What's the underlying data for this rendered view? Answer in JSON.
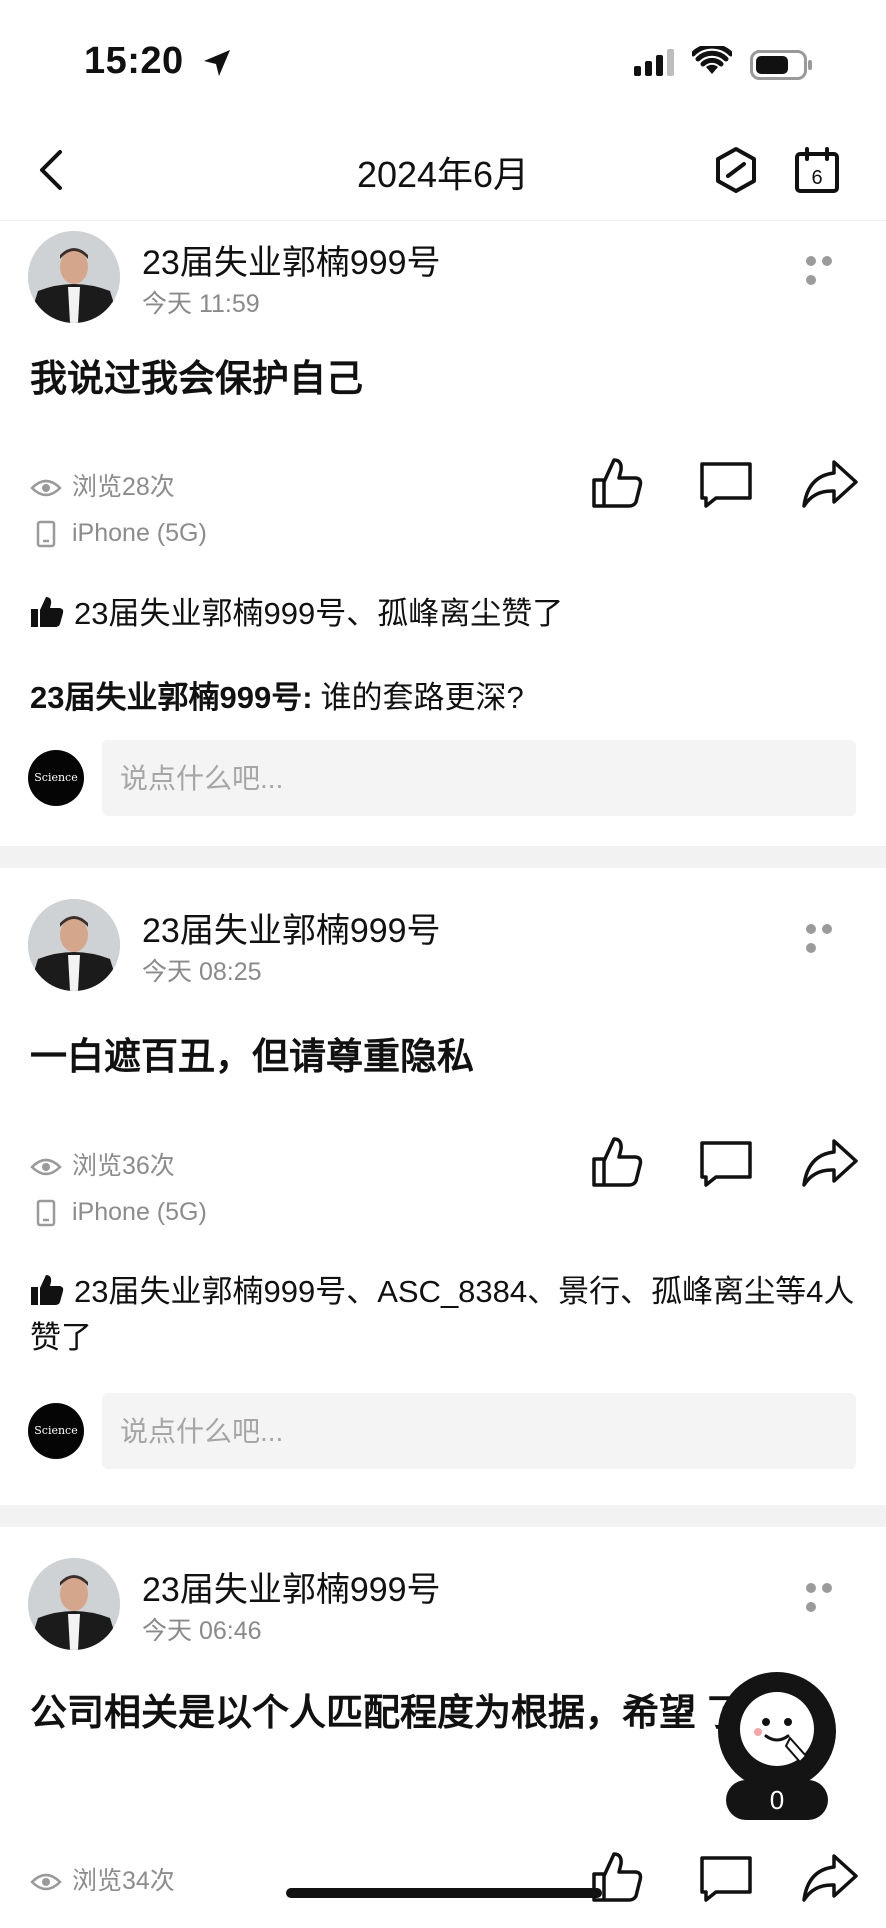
{
  "status_bar": {
    "time": "15:20"
  },
  "nav": {
    "title": "2024年6月",
    "calendar_day": "6"
  },
  "posts": [
    {
      "username": "23届失业郭楠999号",
      "time": "今天 11:59",
      "content": "我说过我会保护自己",
      "views": "浏览28次",
      "device": "iPhone (5G)",
      "likes": "23届失业郭楠999号、孤峰离尘赞了",
      "comment_author": "23届失业郭楠999号:",
      "comment_text": "谁的套路更深?",
      "comment_placeholder": "说点什么吧..."
    },
    {
      "username": "23届失业郭楠999号",
      "time": "今天 08:25",
      "content": "一白遮百丑，但请尊重隐私",
      "views": "浏览36次",
      "device": "iPhone (5G)",
      "likes": "23届失业郭楠999号、ASC_8384、景行、孤峰离尘等4人赞了",
      "comment_placeholder": "说点什么吧..."
    },
    {
      "username": "23届失业郭楠999号",
      "time": "今天 06:46",
      "content": "公司相关是以个人匹配程度为根据，希望          了之",
      "views": "浏览34次"
    }
  ],
  "my_avatar_text": "Science",
  "assistant": {
    "count": "0"
  }
}
